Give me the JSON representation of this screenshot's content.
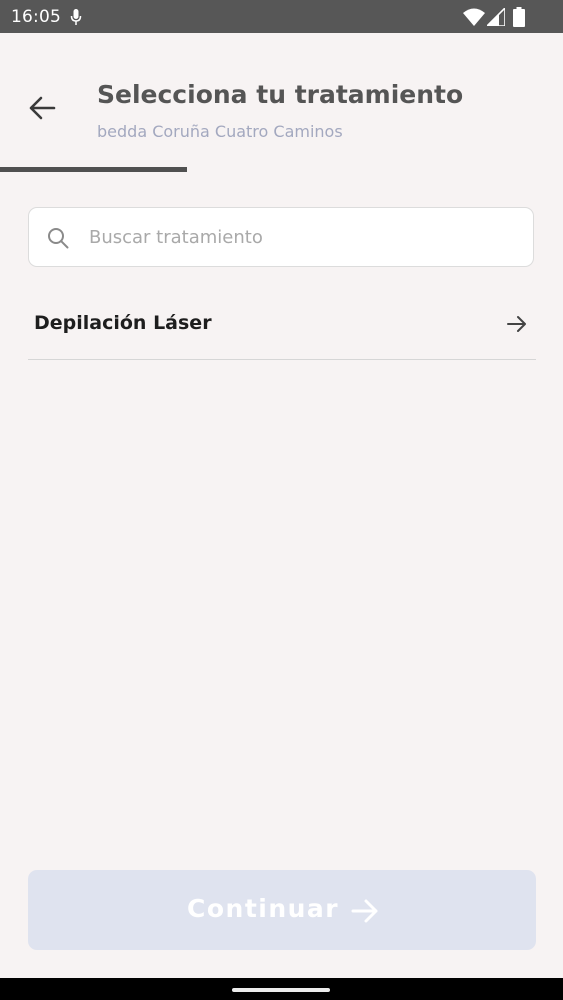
{
  "status_bar": {
    "time": "16:05",
    "icons": [
      "mic-icon",
      "wifi-icon",
      "signal-icon",
      "battery-icon"
    ]
  },
  "header": {
    "back_icon": "arrow-left-icon",
    "title": "Selecciona tu tratamiento",
    "subtitle": "bedda Coruña Cuatro Caminos"
  },
  "progress": {
    "fraction": 0.333
  },
  "search": {
    "icon": "search-icon",
    "placeholder": "Buscar tratamiento",
    "value": ""
  },
  "treatments": [
    {
      "label": "Depilación Láser",
      "icon": "arrow-right-icon"
    }
  ],
  "footer": {
    "continue_label": "Continuar",
    "continue_icon": "arrow-right-icon",
    "disabled": true
  },
  "colors": {
    "background": "#f7f3f3",
    "status_bar": "#575757",
    "title": "#555555",
    "subtitle": "#a3a8bf",
    "progress": "#505050",
    "button_disabled": "#dfe3ef"
  }
}
